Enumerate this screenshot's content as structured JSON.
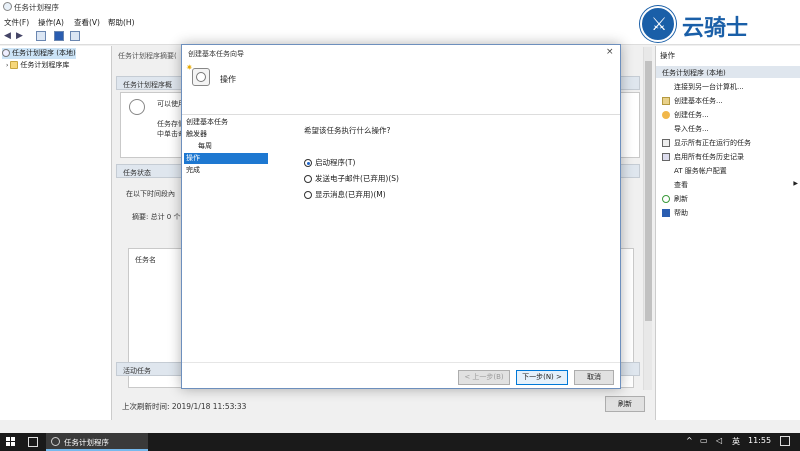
{
  "window": {
    "title": "任务计划程序"
  },
  "menu": {
    "file": "文件(F)",
    "action": "操作(A)",
    "view": "查看(V)",
    "help": "帮助(H)"
  },
  "tree": {
    "root": "任务计划程序 (本地)",
    "library": "任务计划程序库"
  },
  "middle": {
    "title": "任务计划程序摘要(",
    "overview_header": "任务计划程序概",
    "overview_line1": "可以使用",
    "overview_line2": "任务存储",
    "overview_line3": "中单击命",
    "status_header": "任务状态",
    "status_text": "在以下时间段內",
    "summary_text": "摘要: 总计 0 个",
    "task_name_col": "任务名",
    "active_header": "活动任务",
    "last_refresh": "上次刷新时间: 2019/1/18 11:53:33",
    "refresh_button": "刷新"
  },
  "actions": {
    "header": "操作",
    "subheader": "任务计划程序 (本地)",
    "items": [
      "连接到另一台计算机...",
      "创建基本任务...",
      "创建任务...",
      "导入任务...",
      "显示所有正在运行的任务",
      "启用所有任务历史记录",
      "AT 服务帐户配置",
      "查看",
      "刷新",
      "帮助"
    ]
  },
  "brand": {
    "name": "云骑士"
  },
  "wizard": {
    "title": "创建基本任务向导",
    "close": "×",
    "heading": "操作",
    "steps": [
      "创建基本任务",
      "触发器",
      "每周",
      "操作",
      "完成"
    ],
    "active_step": 3,
    "question": "希望该任务执行什么操作?",
    "options": [
      "启动程序(T)",
      "发送电子邮件(已弃用)(S)",
      "显示消息(已弃用)(M)"
    ],
    "selected_option": 0,
    "back_button": "< 上一步(B)",
    "next_button": "下一步(N) >",
    "cancel_button": "取消"
  },
  "taskbar": {
    "app_label": "任务计划程序",
    "ime": "英",
    "time": "11:55"
  },
  "colors": {
    "accent": "#1e78d1",
    "brand": "#1a5fa8",
    "taskbar": "#1a1a1a"
  }
}
